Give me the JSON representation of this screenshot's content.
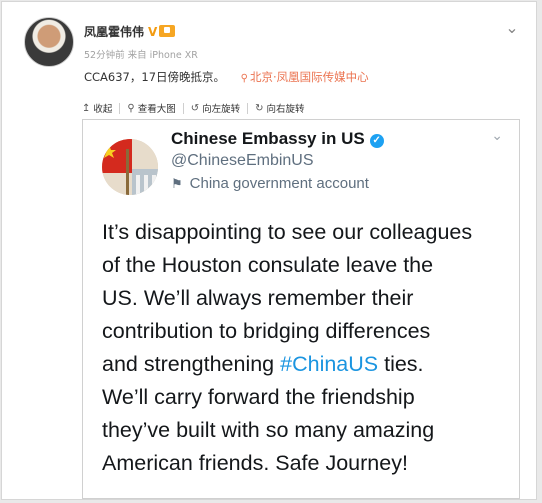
{
  "post": {
    "author": "凤凰霍伟伟",
    "verified_mark": "V",
    "meta": "52分钟前 来自 iPhone XR",
    "text": "CCA637，17日傍晚抵京。",
    "location": "北京·凤凰国际传媒中心"
  },
  "toolbar": {
    "collect": "收起",
    "view_large": "查看大图",
    "rotate_left": "向左旋转",
    "rotate_right": "向右旋转"
  },
  "tweet": {
    "name": "Chinese Embassy in US",
    "handle": "@ChineseEmbinUS",
    "label": "China government account",
    "lines": [
      "It’s disappointing to see our colleagues",
      "of the Houston consulate leave the",
      "US. We’ll always remember their",
      "contribution to bridging differences"
    ],
    "line5_before": "and strengthening ",
    "hashtag": "#ChinaUS",
    "line5_after": " ties.",
    "lines_after": [
      "We’ll carry forward the friendship",
      "they’ve built with so many amazing",
      "American friends. Safe Journey!"
    ]
  },
  "icons": [
    "chevron-down-icon",
    "location-pin-icon",
    "collapse-icon",
    "zoom-icon",
    "rotate-left-icon",
    "rotate-right-icon",
    "verified-icon",
    "flag-icon"
  ],
  "colors": {
    "location": "#eb7350",
    "verified_badge": "#f29b11",
    "twitter_verified": "#1da1f2",
    "hashtag": "#1b95e0"
  }
}
